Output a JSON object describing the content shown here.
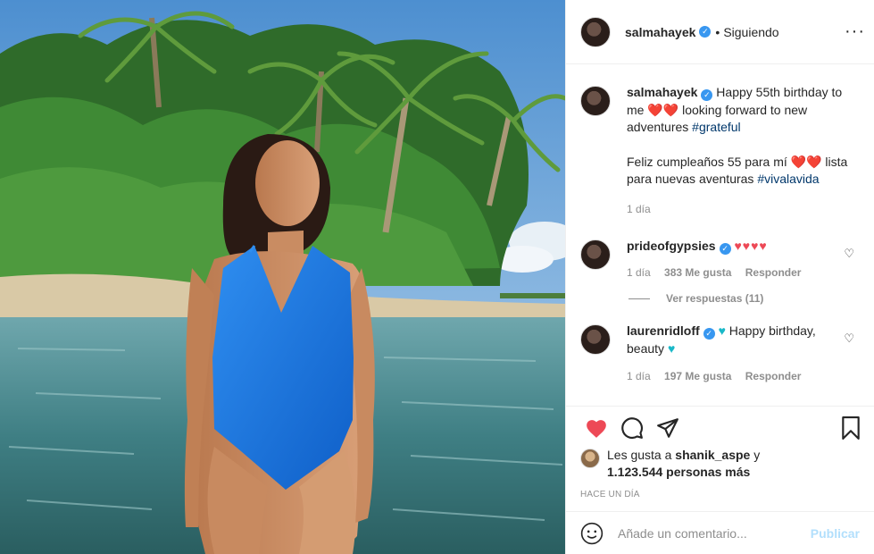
{
  "post": {
    "author": "salmahayek",
    "follow_state": "Siguiendo",
    "separator": "•"
  },
  "caption": {
    "author": "salmahayek",
    "text_1": "Happy 55th birthday to me ❤️❤️ looking forward to new adventures ",
    "hashtag_1": "#grateful",
    "text_2": "Feliz cumpleaños 55 para mí ❤️❤️ lista para nuevas aventuras ",
    "hashtag_2": "#vivalavida",
    "time": "1 día"
  },
  "comments": [
    {
      "author": "prideofgypsies",
      "text": "♥♥♥♥",
      "time": "1 día",
      "likes": "383 Me gusta",
      "reply": "Responder",
      "view_replies": "Ver respuestas (11)"
    },
    {
      "author": "laurenridloff",
      "text_1": "♥ Happy birthday, beauty ",
      "text_2": "♥",
      "time": "1 día",
      "likes": "197 Me gusta",
      "reply": "Responder"
    }
  ],
  "likes": {
    "prefix": "Les gusta a",
    "user": "shanik_aspe",
    "conj": "y",
    "count": "1.123.544 personas más"
  },
  "time_ago": "HACE UN DÍA",
  "add_comment": {
    "placeholder": "Añade un comentario...",
    "publish": "Publicar"
  },
  "colors": {
    "link": "#00376b",
    "like_red": "#ed4956",
    "verified_blue": "#3897f0",
    "publish_disabled": "#b2dffc"
  }
}
